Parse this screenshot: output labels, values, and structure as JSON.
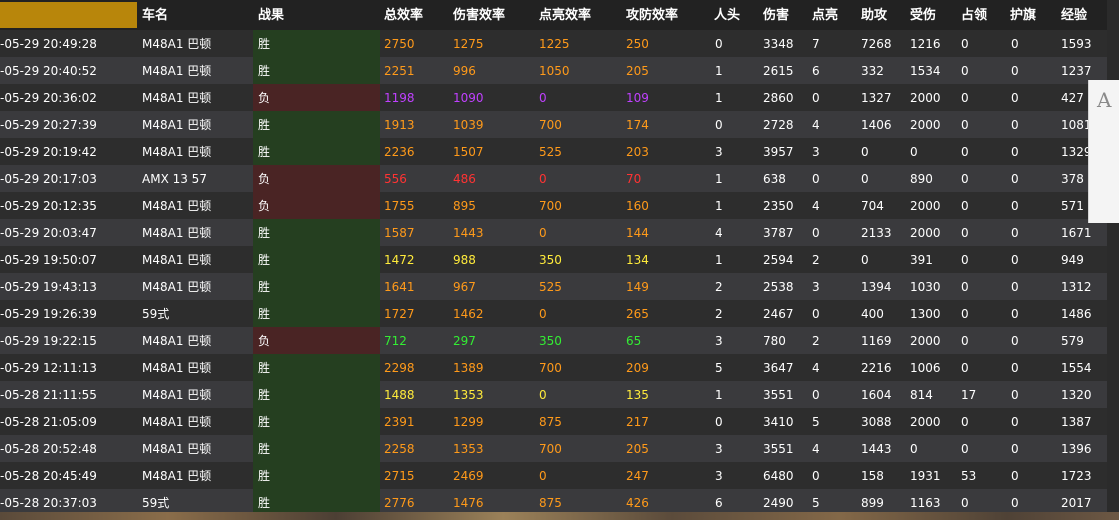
{
  "columns": [
    "车名",
    "战果",
    "总效率",
    "伤害效率",
    "点亮效率",
    "攻防效率",
    "人头",
    "伤害",
    "点亮",
    "助攻",
    "受伤",
    "占领",
    "护旗",
    "经验"
  ],
  "colors": {
    "orange": "#ff9a1a",
    "yellow": "#ffeb3b",
    "purple": "#c040ff",
    "red": "#ff3333",
    "green": "#33ee33",
    "white": "#ffffff",
    "win_bg": "#253f20",
    "lose_bg": "#4a2424"
  },
  "rows": [
    {
      "time": "-05-29 20:49:28",
      "tank": "M48A1 巴顿",
      "result": "胜",
      "outcome": "win",
      "total": "2750",
      "damage_eff": "1275",
      "spot_eff": "1225",
      "def_eff": "250",
      "eff_color": "orange",
      "kills": "0",
      "damage": "3348",
      "spots": "7",
      "assist": "7268",
      "taken": "1216",
      "capture": "0",
      "defend": "0",
      "xp": "1593"
    },
    {
      "time": "-05-29 20:40:52",
      "tank": "M48A1 巴顿",
      "result": "胜",
      "outcome": "win",
      "total": "2251",
      "damage_eff": "996",
      "spot_eff": "1050",
      "def_eff": "205",
      "eff_color": "orange",
      "kills": "1",
      "damage": "2615",
      "spots": "6",
      "assist": "332",
      "taken": "1534",
      "capture": "0",
      "defend": "0",
      "xp": "1237"
    },
    {
      "time": "-05-29 20:36:02",
      "tank": "M48A1 巴顿",
      "result": "负",
      "outcome": "lose",
      "total": "1198",
      "damage_eff": "1090",
      "spot_eff": "0",
      "def_eff": "109",
      "eff_color": "purple",
      "kills": "1",
      "damage": "2860",
      "spots": "0",
      "assist": "1327",
      "taken": "2000",
      "capture": "0",
      "defend": "0",
      "xp": "427"
    },
    {
      "time": "-05-29 20:27:39",
      "tank": "M48A1 巴顿",
      "result": "胜",
      "outcome": "win",
      "total": "1913",
      "damage_eff": "1039",
      "spot_eff": "700",
      "def_eff": "174",
      "eff_color": "orange",
      "kills": "0",
      "damage": "2728",
      "spots": "4",
      "assist": "1406",
      "taken": "2000",
      "capture": "0",
      "defend": "0",
      "xp": "1081"
    },
    {
      "time": "-05-29 20:19:42",
      "tank": "M48A1 巴顿",
      "result": "胜",
      "outcome": "win",
      "total": "2236",
      "damage_eff": "1507",
      "spot_eff": "525",
      "def_eff": "203",
      "eff_color": "orange",
      "kills": "3",
      "damage": "3957",
      "spots": "3",
      "assist": "0",
      "taken": "0",
      "capture": "0",
      "defend": "0",
      "xp": "1329"
    },
    {
      "time": "-05-29 20:17:03",
      "tank": "AMX 13 57",
      "result": "负",
      "outcome": "lose",
      "total": "556",
      "damage_eff": "486",
      "spot_eff": "0",
      "def_eff": "70",
      "eff_color": "red",
      "kills": "1",
      "damage": "638",
      "spots": "0",
      "assist": "0",
      "taken": "890",
      "capture": "0",
      "defend": "0",
      "xp": "378"
    },
    {
      "time": "-05-29 20:12:35",
      "tank": "M48A1 巴顿",
      "result": "负",
      "outcome": "lose",
      "total": "1755",
      "damage_eff": "895",
      "spot_eff": "700",
      "def_eff": "160",
      "eff_color": "orange",
      "kills": "1",
      "damage": "2350",
      "spots": "4",
      "assist": "704",
      "taken": "2000",
      "capture": "0",
      "defend": "0",
      "xp": "571"
    },
    {
      "time": "-05-29 20:03:47",
      "tank": "M48A1 巴顿",
      "result": "胜",
      "outcome": "win",
      "total": "1587",
      "damage_eff": "1443",
      "spot_eff": "0",
      "def_eff": "144",
      "eff_color": "orange",
      "kills": "4",
      "damage": "3787",
      "spots": "0",
      "assist": "2133",
      "taken": "2000",
      "capture": "0",
      "defend": "0",
      "xp": "1671"
    },
    {
      "time": "-05-29 19:50:07",
      "tank": "M48A1 巴顿",
      "result": "胜",
      "outcome": "win",
      "total": "1472",
      "damage_eff": "988",
      "spot_eff": "350",
      "def_eff": "134",
      "eff_color": "yellow",
      "kills": "1",
      "damage": "2594",
      "spots": "2",
      "assist": "0",
      "taken": "391",
      "capture": "0",
      "defend": "0",
      "xp": "949"
    },
    {
      "time": "-05-29 19:43:13",
      "tank": "M48A1 巴顿",
      "result": "胜",
      "outcome": "win",
      "total": "1641",
      "damage_eff": "967",
      "spot_eff": "525",
      "def_eff": "149",
      "eff_color": "orange",
      "kills": "2",
      "damage": "2538",
      "spots": "3",
      "assist": "1394",
      "taken": "1030",
      "capture": "0",
      "defend": "0",
      "xp": "1312"
    },
    {
      "time": "-05-29 19:26:39",
      "tank": "59式",
      "result": "胜",
      "outcome": "win",
      "total": "1727",
      "damage_eff": "1462",
      "spot_eff": "0",
      "def_eff": "265",
      "eff_color": "orange",
      "kills": "2",
      "damage": "2467",
      "spots": "0",
      "assist": "400",
      "taken": "1300",
      "capture": "0",
      "defend": "0",
      "xp": "1486"
    },
    {
      "time": "-05-29 19:22:15",
      "tank": "M48A1 巴顿",
      "result": "负",
      "outcome": "lose",
      "total": "712",
      "damage_eff": "297",
      "spot_eff": "350",
      "def_eff": "65",
      "eff_color": "green",
      "kills": "3",
      "damage": "780",
      "spots": "2",
      "assist": "1169",
      "taken": "2000",
      "capture": "0",
      "defend": "0",
      "xp": "579"
    },
    {
      "time": "-05-29 12:11:13",
      "tank": "M48A1 巴顿",
      "result": "胜",
      "outcome": "win",
      "total": "2298",
      "damage_eff": "1389",
      "spot_eff": "700",
      "def_eff": "209",
      "eff_color": "orange",
      "kills": "5",
      "damage": "3647",
      "spots": "4",
      "assist": "2216",
      "taken": "1006",
      "capture": "0",
      "defend": "0",
      "xp": "1554"
    },
    {
      "time": "-05-28 21:11:55",
      "tank": "M48A1 巴顿",
      "result": "胜",
      "outcome": "win",
      "total": "1488",
      "damage_eff": "1353",
      "spot_eff": "0",
      "def_eff": "135",
      "eff_color": "yellow",
      "kills": "1",
      "damage": "3551",
      "spots": "0",
      "assist": "1604",
      "taken": "814",
      "capture": "17",
      "defend": "0",
      "xp": "1320"
    },
    {
      "time": "-05-28 21:05:09",
      "tank": "M48A1 巴顿",
      "result": "胜",
      "outcome": "win",
      "total": "2391",
      "damage_eff": "1299",
      "spot_eff": "875",
      "def_eff": "217",
      "eff_color": "orange",
      "kills": "0",
      "damage": "3410",
      "spots": "5",
      "assist": "3088",
      "taken": "2000",
      "capture": "0",
      "defend": "0",
      "xp": "1387"
    },
    {
      "time": "-05-28 20:52:48",
      "tank": "M48A1 巴顿",
      "result": "胜",
      "outcome": "win",
      "total": "2258",
      "damage_eff": "1353",
      "spot_eff": "700",
      "def_eff": "205",
      "eff_color": "orange",
      "kills": "3",
      "damage": "3551",
      "spots": "4",
      "assist": "1443",
      "taken": "0",
      "capture": "0",
      "defend": "0",
      "xp": "1396"
    },
    {
      "time": "-05-28 20:45:49",
      "tank": "M48A1 巴顿",
      "result": "胜",
      "outcome": "win",
      "total": "2715",
      "damage_eff": "2469",
      "spot_eff": "0",
      "def_eff": "247",
      "eff_color": "orange",
      "kills": "3",
      "damage": "6480",
      "spots": "0",
      "assist": "158",
      "taken": "1931",
      "capture": "53",
      "defend": "0",
      "xp": "1723"
    },
    {
      "time": "-05-28 20:37:03",
      "tank": "59式",
      "result": "胜",
      "outcome": "win",
      "total": "2776",
      "damage_eff": "1476",
      "spot_eff": "875",
      "def_eff": "426",
      "eff_color": "orange",
      "kills": "6",
      "damage": "2490",
      "spots": "5",
      "assist": "899",
      "taken": "1163",
      "capture": "0",
      "defend": "0",
      "xp": "2017"
    }
  ],
  "side_panel": {
    "font_icon": "A"
  }
}
